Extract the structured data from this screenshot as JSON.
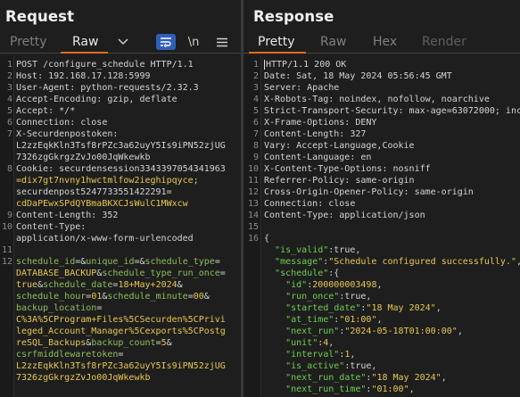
{
  "request": {
    "title": "Request",
    "tabs": [
      "Pretty",
      "Raw"
    ],
    "icons": {
      "dropdown": "chevron-down-icon",
      "wrap": "wrap-lines-icon",
      "newline": "\\n",
      "menu": "hamburger-menu-icon"
    },
    "lines": [
      {
        "n": "1",
        "t": "POST /configure_schedule HTTP/1.1"
      },
      {
        "n": "2",
        "t": "Host: 192.168.17.128:5999"
      },
      {
        "n": "3",
        "t": "User-Agent: python-requests/2.32.3"
      },
      {
        "n": "4",
        "t": "Accept-Encoding: gzip, deflate"
      },
      {
        "n": "5",
        "t": "Accept: */*"
      },
      {
        "n": "6",
        "t": "Connection: close"
      },
      {
        "n": "7",
        "t": "X-Securdenpostoken:"
      },
      {
        "n": "",
        "t": "L2zzEqkKln3Tsf8rPZc3a62uyY5Is9iPN52zjUG"
      },
      {
        "n": "",
        "t": "7326zgGkrgzZvJo00JqWkewkb"
      },
      {
        "n": "8",
        "t": "Cookie: securdensession3343397054341963"
      },
      {
        "n": "",
        "t": "=dix7gt7nvny1hwctmlfow2ieghipqyce;"
      },
      {
        "n": "",
        "t": "securdenpost5247733551422291="
      },
      {
        "n": "",
        "t": "cdDaPEwxSPdQYBmaBKXCJsWulC1MWxcw"
      },
      {
        "n": "9",
        "t": "Content-Length: 352"
      },
      {
        "n": "10",
        "t": "Content-Type:"
      },
      {
        "n": "",
        "t": "application/x-www-form-urlencoded"
      },
      {
        "n": "11",
        "t": ""
      },
      {
        "n": "12",
        "t": "schedule_id=&unique_id=&schedule_type="
      },
      {
        "n": "",
        "t": "DATABASE_BACKUP&schedule_type_run_once="
      },
      {
        "n": "",
        "t": "true&schedule_date=18+May+2024&"
      },
      {
        "n": "",
        "t": "schedule_hour=01&schedule_minute=00&"
      },
      {
        "n": "",
        "t": "backup_location="
      },
      {
        "n": "",
        "t": "C%3A%5CProgram+Files%5CSecurden%5CPrivi"
      },
      {
        "n": "",
        "t": "leged_Account_Manager%5Cexports%5CPostg"
      },
      {
        "n": "",
        "t": "reSQL_Backups&backup_count=5&"
      },
      {
        "n": "",
        "t": "csrfmiddlewaretoken="
      },
      {
        "n": "",
        "t": "L2zzEqkKln3Tsf8rPZc3a62uyY5Is9iPN52zjUG"
      },
      {
        "n": "",
        "t": "7326zgGkrgzZvJo00JqWkewkb"
      }
    ]
  },
  "response": {
    "title": "Response",
    "tabs": [
      "Pretty",
      "Raw",
      "Hex",
      "Render"
    ],
    "lines": [
      {
        "n": "1",
        "t": "HTTP/1.1 200 OK"
      },
      {
        "n": "2",
        "t": "Date: Sat, 18 May 2024 05:56:45 GMT"
      },
      {
        "n": "3",
        "t": "Server: Apache"
      },
      {
        "n": "4",
        "t": "X-Robots-Tag: noindex, nofollow, noarchive"
      },
      {
        "n": "5",
        "t": "Strict-Transport-Security: max-age=63072000; inc"
      },
      {
        "n": "6",
        "t": "X-Frame-Options: DENY"
      },
      {
        "n": "7",
        "t": "Content-Length: 327"
      },
      {
        "n": "8",
        "t": "Vary: Accept-Language,Cookie"
      },
      {
        "n": "9",
        "t": "Content-Language: en"
      },
      {
        "n": "10",
        "t": "X-Content-Type-Options: nosniff"
      },
      {
        "n": "11",
        "t": "Referrer-Policy: same-origin"
      },
      {
        "n": "12",
        "t": "Cross-Origin-Opener-Policy: same-origin"
      },
      {
        "n": "13",
        "t": "Connection: close"
      },
      {
        "n": "14",
        "t": "Content-Type: application/json"
      },
      {
        "n": "15",
        "t": ""
      },
      {
        "n": "16",
        "t": "{"
      },
      {
        "n": "",
        "t": "  \"is_valid\":true,"
      },
      {
        "n": "",
        "t": "  \"message\":\"Schedule configured successfully.\","
      },
      {
        "n": "",
        "t": "  \"schedule\":{"
      },
      {
        "n": "",
        "t": "    \"id\":200000003498,"
      },
      {
        "n": "",
        "t": "    \"run_once\":true,"
      },
      {
        "n": "",
        "t": "    \"started_date\":\"18 May 2024\","
      },
      {
        "n": "",
        "t": "    \"at_time\":\"01:00\","
      },
      {
        "n": "",
        "t": "    \"next_run\":\"2024-05-18T01:00:00\","
      },
      {
        "n": "",
        "t": "    \"unit\":4,"
      },
      {
        "n": "",
        "t": "    \"interval\":1,"
      },
      {
        "n": "",
        "t": "    \"is_active\":true,"
      },
      {
        "n": "",
        "t": "    \"next_run_date\":\"18 May 2024\","
      },
      {
        "n": "",
        "t": "    \"next_run_time\":\"01:00\","
      }
    ]
  },
  "colors": {
    "accent": "#e06c20",
    "background": "#1e1e1e",
    "json_key": "#6fcf4f",
    "string_value": "#e8c94f",
    "cookie_value": "#e8c94f",
    "param_name": "#8fbf5a"
  }
}
